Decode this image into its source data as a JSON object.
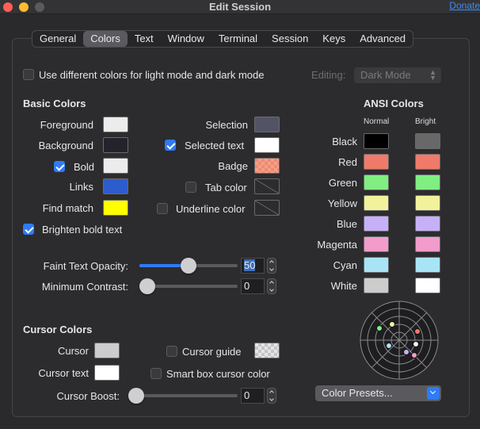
{
  "window": {
    "title": "Edit Session",
    "donate": "Donate",
    "traffic_lights": {
      "close": "#ff5f57",
      "minimize": "#febc2e",
      "zoom": "#5a5a5e"
    }
  },
  "tabs": [
    {
      "label": "General",
      "active": false
    },
    {
      "label": "Colors",
      "active": true
    },
    {
      "label": "Text",
      "active": false
    },
    {
      "label": "Window",
      "active": false
    },
    {
      "label": "Terminal",
      "active": false
    },
    {
      "label": "Session",
      "active": false
    },
    {
      "label": "Keys",
      "active": false
    },
    {
      "label": "Advanced",
      "active": false
    }
  ],
  "mode": {
    "checkbox_label": "Use different colors for light mode and dark mode",
    "checked": false,
    "editing_label": "Editing:",
    "editing_value": "Dark Mode"
  },
  "basic": {
    "heading": "Basic Colors",
    "foreground": {
      "label": "Foreground",
      "color": "#ececec"
    },
    "background": {
      "label": "Background",
      "color": "#24232b"
    },
    "bold": {
      "label": "Bold",
      "checked": true,
      "color": "#ececec"
    },
    "links": {
      "label": "Links",
      "color": "#2d5ccc"
    },
    "find_match": {
      "label": "Find match",
      "color": "#ffff00"
    },
    "selection": {
      "label": "Selection",
      "color": "#535366"
    },
    "selected_text": {
      "label": "Selected text",
      "checked": true,
      "color": "#ffffff"
    },
    "badge": {
      "label": "Badge",
      "color": "#f08a70"
    },
    "tab_color": {
      "label": "Tab color",
      "checked": false
    },
    "underline_color": {
      "label": "Underline color",
      "checked": false
    },
    "brighten_bold": {
      "label": "Brighten bold text",
      "checked": true
    }
  },
  "faint": {
    "label": "Faint Text Opacity:",
    "value": "50",
    "fraction": 0.5
  },
  "contrast": {
    "label": "Minimum Contrast:",
    "value": "0",
    "fraction": 0
  },
  "ansi": {
    "heading": "ANSI Colors",
    "normal_label": "Normal",
    "bright_label": "Bright",
    "rows": [
      {
        "name": "Black",
        "normal": "#000000",
        "bright": "#686868"
      },
      {
        "name": "Red",
        "normal": "#f07a6a",
        "bright": "#f07a6a"
      },
      {
        "name": "Green",
        "normal": "#80ee80",
        "bright": "#80ee80"
      },
      {
        "name": "Yellow",
        "normal": "#f2f29c",
        "bright": "#f2f29c"
      },
      {
        "name": "Blue",
        "normal": "#c6b1f8",
        "bright": "#c6b1f8"
      },
      {
        "name": "Magenta",
        "normal": "#f29ccc",
        "bright": "#f29ccc"
      },
      {
        "name": "Cyan",
        "normal": "#a8e4f6",
        "bright": "#a8e4f6"
      },
      {
        "name": "White",
        "normal": "#cccccc",
        "bright": "#ffffff"
      }
    ]
  },
  "cursor": {
    "heading": "Cursor Colors",
    "cursor": {
      "label": "Cursor",
      "color": "#cccccc"
    },
    "cursor_text": {
      "label": "Cursor text",
      "color": "#ffffff"
    },
    "cursor_guide": {
      "label": "Cursor guide",
      "checked": false
    },
    "smart_box": {
      "label": "Smart box cursor color",
      "checked": false
    },
    "boost": {
      "label": "Cursor Boost:",
      "value": "0",
      "fraction": 0
    }
  },
  "presets": {
    "label": "Color Presets..."
  },
  "wheel_points": [
    {
      "color": "#80ee80"
    },
    {
      "color": "#f2f29c"
    },
    {
      "color": "#f07a6a"
    },
    {
      "color": "#f2f2f2"
    },
    {
      "color": "#a8e4f6"
    },
    {
      "color": "#c6b1f8"
    },
    {
      "color": "#f29ccc"
    }
  ]
}
